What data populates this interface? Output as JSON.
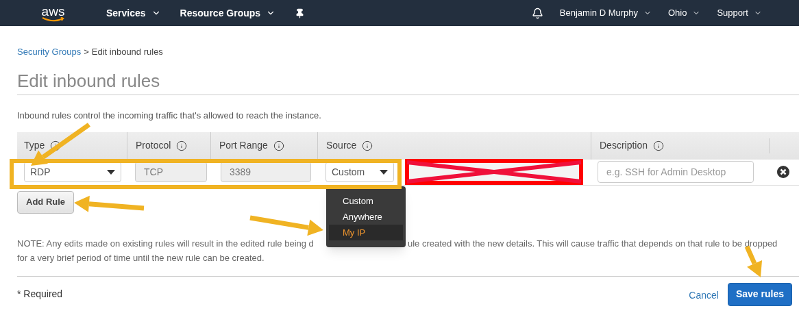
{
  "navbar": {
    "logo": "aws",
    "menus": [
      {
        "label": "Services"
      },
      {
        "label": "Resource Groups"
      }
    ],
    "right_menus": [
      {
        "label": "Benjamin D Murphy"
      },
      {
        "label": "Ohio"
      },
      {
        "label": "Support"
      }
    ]
  },
  "breadcrumb": {
    "link": "Security Groups",
    "separator": ">",
    "current": "Edit inbound rules"
  },
  "title": "Edit inbound rules",
  "intro": "Inbound rules control the incoming traffic that's allowed to reach the instance.",
  "table": {
    "columns": [
      "Type",
      "Protocol",
      "Port Range",
      "Source",
      "Description"
    ],
    "rows": [
      {
        "type": "RDP",
        "protocol": "TCP",
        "port_range": "3389",
        "source": "Custom",
        "source_redacted": true,
        "description_placeholder": "e.g. SSH for Admin Desktop"
      }
    ]
  },
  "add_rule": "Add Rule",
  "source_menu": [
    {
      "label": "Custom",
      "selected": false
    },
    {
      "label": "Anywhere",
      "selected": false
    },
    {
      "label": "My IP",
      "selected": true
    }
  ],
  "note": {
    "line_1_start": "NOTE: Any edits made on existing rules will result in the edited rule being d",
    "line_1_end": "ule created with the new details. This will cause traffic that depends on that rule to be dropped",
    "line_2": "for a very brief period of time until the new rule can be created."
  },
  "footer": {
    "required": "* Required",
    "cancel": "Cancel",
    "save": "Save rules"
  }
}
